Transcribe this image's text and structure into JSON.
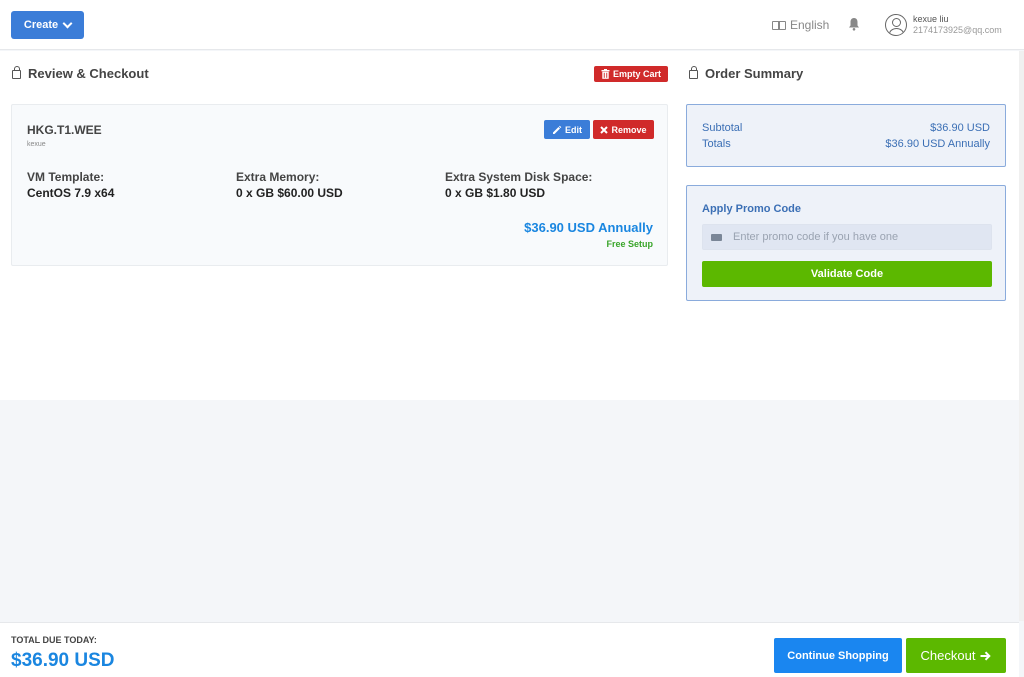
{
  "header": {
    "create_label": "Create",
    "language_label": "English",
    "user_name": "kexue liu",
    "user_email": "2174173925@qq.com"
  },
  "review": {
    "title": "Review & Checkout",
    "empty_cart_label": "Empty Cart",
    "item": {
      "name": "HKG.T1.WEE",
      "group": "kexue",
      "edit_label": "Edit",
      "remove_label": "Remove",
      "configs": [
        {
          "label": "VM Template:",
          "value": "CentOS 7.9 x64"
        },
        {
          "label": "Extra Memory:",
          "value": "0 x GB $60.00 USD"
        },
        {
          "label": "Extra System Disk Space:",
          "value": "0 x GB $1.80 USD"
        }
      ],
      "price": "$36.90 USD Annually",
      "setup": "Free Setup"
    }
  },
  "summary": {
    "title": "Order Summary",
    "subtotal_label": "Subtotal",
    "subtotal_value": "$36.90 USD",
    "totals_label": "Totals",
    "totals_value": "$36.90 USD Annually"
  },
  "promo": {
    "title": "Apply Promo Code",
    "placeholder": "Enter promo code if you have one",
    "validate_label": "Validate Code"
  },
  "footer": {
    "due_label": "TOTAL DUE TODAY:",
    "due_value": "$36.90 USD",
    "continue_label": "Continue Shopping",
    "checkout_label": "Checkout"
  },
  "colors": {
    "primary": "#3b7dd8",
    "accent_blue": "#1a86e0",
    "danger": "#d02a2a",
    "success": "#5cb800"
  }
}
